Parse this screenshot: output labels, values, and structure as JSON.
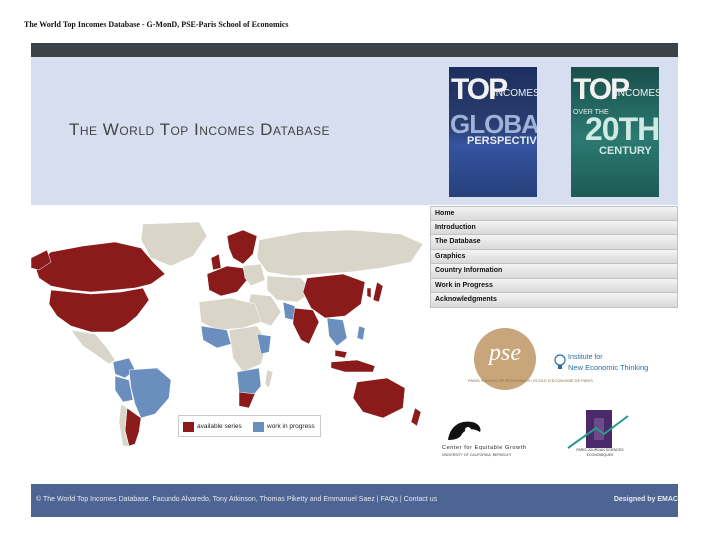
{
  "page_title": "The World Top Incomes Database - G-MonD, PSE-Paris School of Economics",
  "banner": {
    "title": "The World Top Incomes Database",
    "book1": {
      "line1": "TOP",
      "line2": "INCOMES",
      "line3": "GLOBAL",
      "line4": "PERSPECTIVE"
    },
    "book2": {
      "line1": "TOP",
      "line2": "INCOMES",
      "line3": "OVER THE",
      "line4": "20TH",
      "line5": "CENTURY"
    }
  },
  "nav": [
    "Home",
    "Introduction",
    "The Database",
    "Graphics",
    "Country Information",
    "Work in Progress",
    "Acknowledgments"
  ],
  "map": {
    "legend": [
      {
        "label": "available series",
        "color": "#8b1a1a"
      },
      {
        "label": "work in progress",
        "color": "#6a8fbe"
      }
    ],
    "colors": {
      "available": "#8b1a1a",
      "work_in_progress": "#6a8fbe",
      "other": "#d9d6c9"
    }
  },
  "logos": {
    "pse_mark": "pse",
    "pse_caption": "PARIS SCHOOL OF ECONOMICS / ECOLE D'ECONOMIE DE PARIS",
    "inet_line1": "Institute for",
    "inet_line2": "New Economic Thinking",
    "ceg_name": "Center for Equitable Growth",
    "ceg_sub": "UNIVERSITY OF CALIFORNIA, BERKELEY",
    "ppe_caption": "PARIS-JOURDAN SCIENCES ECONOMIQUES"
  },
  "footer": {
    "left": "© The World Top Incomes Database. Facundo Alvaredo, Tony Atkinson, Thomas Piketty and Emmanuel Saez | FAQs | Contact us",
    "right": "Designed by EMAC"
  }
}
